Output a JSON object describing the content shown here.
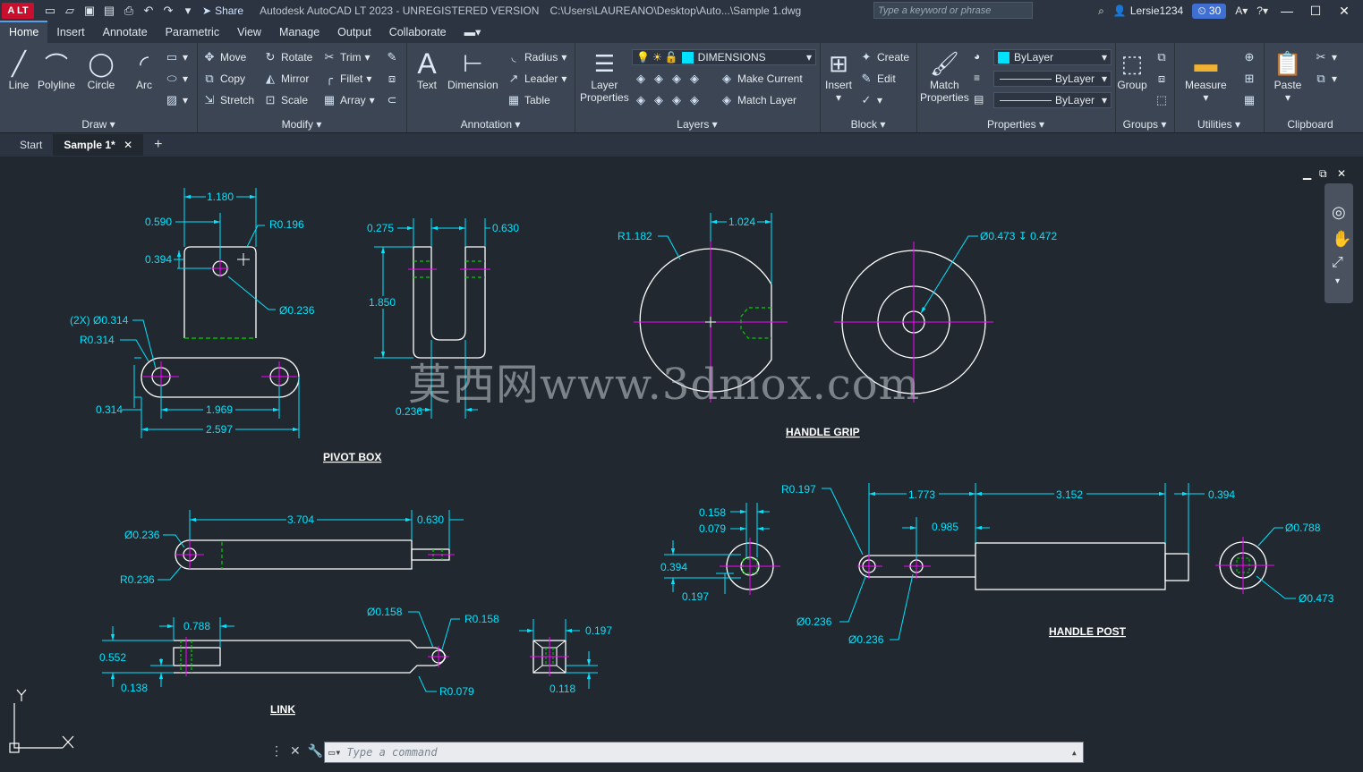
{
  "titlebar": {
    "logo": "A LT",
    "share": "Share",
    "title": "Autodesk AutoCAD LT 2023 - UNREGISTERED VERSION",
    "path": "C:\\Users\\LAUREANO\\Desktop\\Auto...\\Sample 1.dwg",
    "search_placeholder": "Type a keyword or phrase",
    "user": "Lersie1234",
    "trial_days": "30"
  },
  "ribbon_tabs": [
    "Home",
    "Insert",
    "Annotate",
    "Parametric",
    "View",
    "Manage",
    "Output",
    "Collaborate"
  ],
  "ribbon": {
    "draw": {
      "title": "Draw",
      "line": "Line",
      "polyline": "Polyline",
      "circle": "Circle",
      "arc": "Arc"
    },
    "modify": {
      "title": "Modify",
      "move": "Move",
      "rotate": "Rotate",
      "trim": "Trim",
      "copy": "Copy",
      "mirror": "Mirror",
      "fillet": "Fillet",
      "stretch": "Stretch",
      "scale": "Scale",
      "array": "Array"
    },
    "annotation": {
      "title": "Annotation",
      "text": "Text",
      "dimension": "Dimension",
      "radius": "Radius",
      "leader": "Leader",
      "table": "Table"
    },
    "layers": {
      "title": "Layers",
      "layer_properties_1": "Layer",
      "layer_properties_2": "Properties",
      "current_layer": "DIMENSIONS",
      "make_current": "Make Current",
      "match_layer": "Match Layer"
    },
    "block": {
      "title": "Block",
      "insert": "Insert",
      "create": "Create",
      "edit": "Edit"
    },
    "properties": {
      "title": "Properties",
      "match_1": "Match",
      "match_2": "Properties",
      "color": "ByLayer",
      "linetype": "ByLayer",
      "lineweight": "ByLayer"
    },
    "groups": {
      "title": "Groups",
      "group": "Group"
    },
    "utilities": {
      "title": "Utilities",
      "measure": "Measure"
    },
    "clipboard": {
      "title": "Clipboard",
      "paste": "Paste"
    }
  },
  "file_tabs": {
    "start": "Start",
    "active": "Sample 1*"
  },
  "drawing": {
    "pivot_box": {
      "title": "PIVOT BOX",
      "dims": [
        "1.180",
        "0.590",
        "R0.196",
        "0.394",
        "Ø0.236",
        "(2X) Ø0.314",
        "R0.314",
        "0.314",
        "1.969",
        "2.597"
      ]
    },
    "u_part": {
      "dims": [
        "0.275",
        "0.630",
        "1.850",
        "0.236"
      ]
    },
    "handle_grip": {
      "title": "HANDLE GRIP",
      "dims": [
        "R1.182",
        "1.024",
        "Ø0.473 ↧ 0.472"
      ]
    },
    "link": {
      "title": "LINK",
      "dims": [
        "3.704",
        "0.630",
        "Ø0.236",
        "R0.236",
        "Ø0.158",
        "R0.158",
        "0.788",
        "0.552",
        "0.138",
        "R0.079",
        "0.197",
        "0.118"
      ]
    },
    "handle_post": {
      "title": "HANDLE POST",
      "dims": [
        "R0.197",
        "1.773",
        "3.152",
        "0.394",
        "0.158",
        "0.079",
        "0.985",
        "0.394",
        "0.197",
        "Ø0.788",
        "Ø0.473",
        "Ø0.236",
        "Ø0.236"
      ]
    },
    "watermark": "莫西网www.3dmox.com",
    "ucs_y": "Y",
    "ucs_x": "X"
  },
  "command": {
    "placeholder": "Type a command"
  },
  "colors": {
    "dim": "#00e5ff",
    "center": "#ff00ff",
    "hidden": "#00d000",
    "geometry": "#ffffff",
    "background": "#212830"
  }
}
